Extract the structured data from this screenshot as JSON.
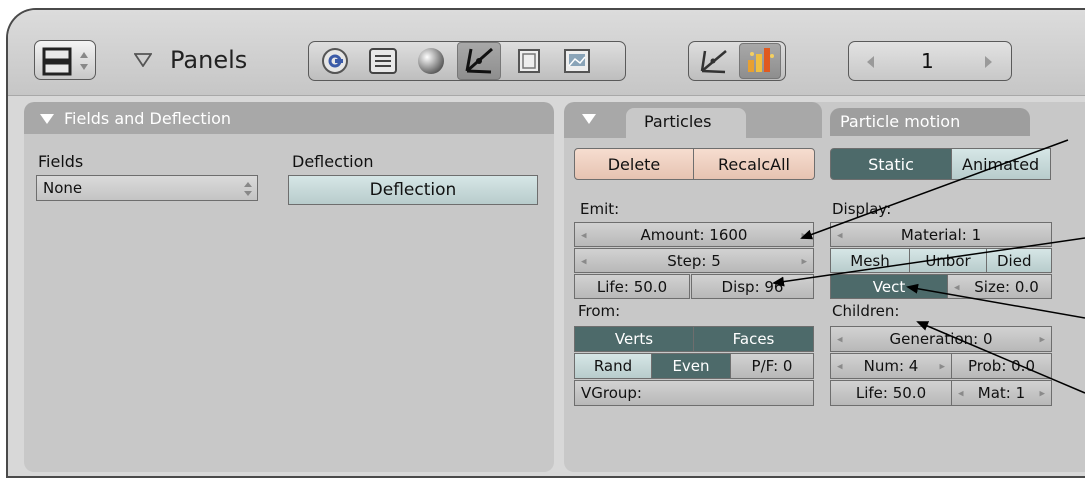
{
  "header": {
    "panels_label": "Panels",
    "frame_number": "1",
    "icons": [
      "window-type-icon",
      "logic-icon",
      "script-icon",
      "shading-icon",
      "object-icon",
      "editing-icon",
      "scene-icon",
      "object-physics-icon",
      "particles-icon"
    ]
  },
  "fields_panel": {
    "title": "Fields and Deflection",
    "fields_label": "Fields",
    "fields_value": "None",
    "deflection_label": "Deflection",
    "deflection_button": "Deflection"
  },
  "particles_panel": {
    "tab_particles": "Particles",
    "tab_motion": "Particle motion",
    "delete": "Delete",
    "recalc_all": "RecalcAll",
    "static": "Static",
    "animated": "Animated",
    "emit_label": "Emit:",
    "amount": "Amount: 1600",
    "step": "Step: 5",
    "life": "Life: 50.0",
    "disp": "Disp: 96",
    "from_label": "From:",
    "verts": "Verts",
    "faces": "Faces",
    "rand": "Rand",
    "even": "Even",
    "pf": "P/F: 0",
    "vgroup": "VGroup:",
    "display_label": "Display:",
    "material": "Material: 1",
    "mesh": "Mesh",
    "unborn": "Unbor",
    "died": "Died",
    "vect": "Vect",
    "size": "Size: 0.0",
    "children_label": "Children:",
    "generation": "Generation: 0",
    "num": "Num: 4",
    "prob": "Prob: 0.0",
    "child_life": "Life: 50.0",
    "mat": "Mat: 1"
  },
  "colors": {
    "active": "#4d6a6a",
    "delete_bg": "#f1d5c7",
    "panel_bg": "#c8c8c8",
    "titlebar": "#a8a8a8"
  }
}
